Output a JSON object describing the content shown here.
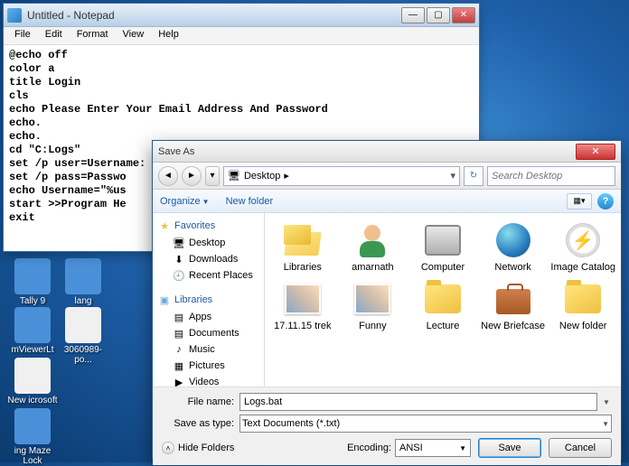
{
  "desktop": {
    "icons": [
      {
        "label": "Tally 9"
      },
      {
        "label": "mViewerLt"
      },
      {
        "label": "New icrosoft .."
      },
      {
        "label": "ing Maze Lock"
      },
      {
        "label": "lang"
      },
      {
        "label": "3060989-po..."
      }
    ]
  },
  "notepad": {
    "title": "Untitled - Notepad",
    "menus": [
      "File",
      "Edit",
      "Format",
      "View",
      "Help"
    ],
    "content": "@echo off\ncolor a\ntitle Login\ncls\necho Please Enter Your Email Address And Password\necho.\necho.\ncd \"C:Logs\"\nset /p user=Username:\nset /p pass=Passwo\necho Username=\"%us\nstart >>Program He\nexit"
  },
  "saveas": {
    "title": "Save As",
    "location": "Desktop",
    "breadcrumb_drop": "▸",
    "search_placeholder": "Search Desktop",
    "toolbar": {
      "organize": "Organize",
      "newfolder": "New folder"
    },
    "sidebar": {
      "favorites": {
        "label": "Favorites",
        "items": [
          "Desktop",
          "Downloads",
          "Recent Places"
        ]
      },
      "libraries": {
        "label": "Libraries",
        "items": [
          "Apps",
          "Documents",
          "Music",
          "Pictures",
          "Videos"
        ]
      }
    },
    "files": [
      {
        "name": "Libraries",
        "kind": "open"
      },
      {
        "name": "amarnath",
        "kind": "avatar"
      },
      {
        "name": "Computer",
        "kind": "computer"
      },
      {
        "name": "Network",
        "kind": "globe"
      },
      {
        "name": "Image Catalog",
        "kind": "catalog"
      },
      {
        "name": "17.11.15 trek",
        "kind": "photo"
      },
      {
        "name": "Funny",
        "kind": "photo"
      },
      {
        "name": "Lecture",
        "kind": "folder"
      },
      {
        "name": "New Briefcase",
        "kind": "briefcase"
      },
      {
        "name": "New folder",
        "kind": "folder"
      }
    ],
    "filename_label": "File name:",
    "filename_value": "Logs.bat",
    "saveastype_label": "Save as type:",
    "saveastype_value": "Text Documents (*.txt)",
    "hide_folders": "Hide Folders",
    "encoding_label": "Encoding:",
    "encoding_value": "ANSI",
    "save_btn": "Save",
    "cancel_btn": "Cancel"
  }
}
